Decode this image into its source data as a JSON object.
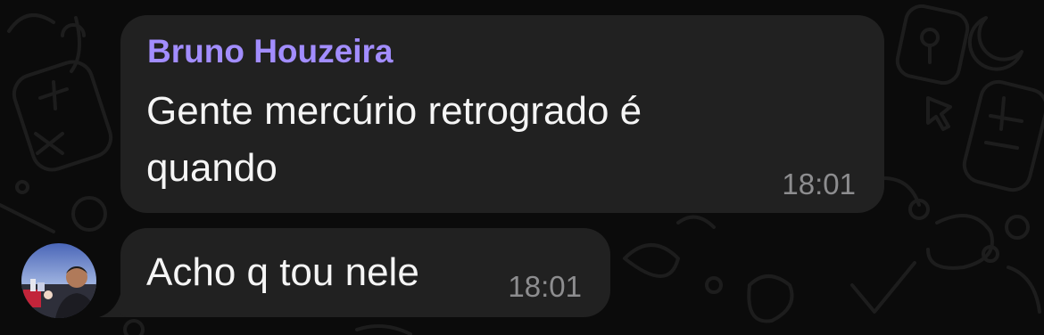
{
  "messages": [
    {
      "sender": "Bruno Houzeira",
      "lines": [
        "Gente mercúrio retrogrado é",
        "quando"
      ],
      "time": "18:01"
    },
    {
      "text": "Acho q tou nele",
      "time": "18:01"
    }
  ],
  "colors": {
    "background": "#0b0b0b",
    "bubble": "#212121",
    "sender_name": "#a28dff",
    "timestamp": "#8d8d8f",
    "message_text": "#f5f5f5"
  },
  "icons": [
    "doodle-wallpaper",
    "avatar-photo"
  ]
}
